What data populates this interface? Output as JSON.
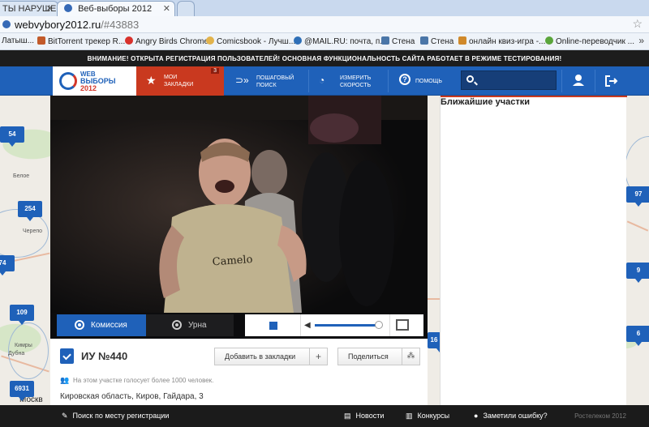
{
  "browser": {
    "tabs": [
      {
        "title": "ТЫ НАРУШЕНИ"
      },
      {
        "title": "Веб-выборы 2012"
      }
    ],
    "address": {
      "host": "webvybory2012.ru",
      "path": "/#43883"
    },
    "bookmarks": [
      {
        "label": "Латыш...",
        "icon": "page-icon"
      },
      {
        "label": "BitTorrent трекер R...",
        "icon": "torrent-icon"
      },
      {
        "label": "Angry Birds Chrome",
        "icon": "bird-icon"
      },
      {
        "label": "Comicsbook - Лучш...",
        "icon": "comics-icon"
      },
      {
        "label": "@MAIL.RU: почта, п...",
        "icon": "mail-icon"
      },
      {
        "label": "Стена",
        "icon": "vk-icon"
      },
      {
        "label": "Стена",
        "icon": "vk-icon"
      },
      {
        "label": "онлайн квиз-игра -...",
        "icon": "quiz-icon"
      },
      {
        "label": "Online-переводчик ...",
        "icon": "translate-icon"
      }
    ],
    "more_label": "»"
  },
  "site": {
    "notice": "ВНИМАНИЕ! ОТКРЫТА РЕГИСТРАЦИЯ ПОЛЬЗОВАТЕЛЕЙ! ОСНОВНАЯ ФУНКЦИОНАЛЬНОСТЬ САЙТА РАБОТАЕТ В РЕЖИМЕ ТЕСТИРОВАНИЯ!",
    "logo": {
      "line1": "WEB",
      "line2": "ВЫБОРЫ",
      "line3": "2012"
    },
    "nav": {
      "bookmarks": {
        "line1": "МОИ",
        "line2": "ЗАКЛАДКИ",
        "badge": "3"
      },
      "search": {
        "line1": "ПОШАГОВЫЙ",
        "line2": "ПОИСК"
      },
      "speed": {
        "line1": "ИЗМЕРИТЬ",
        "line2": "СКОРОСТЬ"
      },
      "help": {
        "label": "ПОМОЩЬ",
        "icon_glyph": "?"
      }
    },
    "search": {
      "placeholder": ""
    },
    "colors": {
      "primary": "#1f61b9",
      "accent": "#c9391f",
      "dark": "#1b1b1b"
    }
  },
  "map": {
    "markers": [
      "54",
      "254",
      "74",
      "109",
      "6931",
      "97",
      "9",
      "6",
      "16"
    ],
    "labels": [
      "Черепо",
      "Кимры",
      "Дубна",
      "Москв",
      "Белое"
    ]
  },
  "video": {
    "commission_label": "Комиссия",
    "urn_label": "Урна"
  },
  "station": {
    "title": "ИУ №440",
    "add_bookmark_label": "Добавить в закладки",
    "add_symbol": "+",
    "share_label": "Поделиться",
    "voters_note": "На этом участке голосует более 1000 человек.",
    "address": "Кировская область, Киров, Гайдара, 3"
  },
  "right_panel": {
    "title": "Ближайшие участки"
  },
  "footer": {
    "search_registration": "Поиск по месту регистрации",
    "news": "Новости",
    "contests": "Конкурсы",
    "report_error": "Заметили ошибку?",
    "copyright": "Ростелеком 2012"
  }
}
